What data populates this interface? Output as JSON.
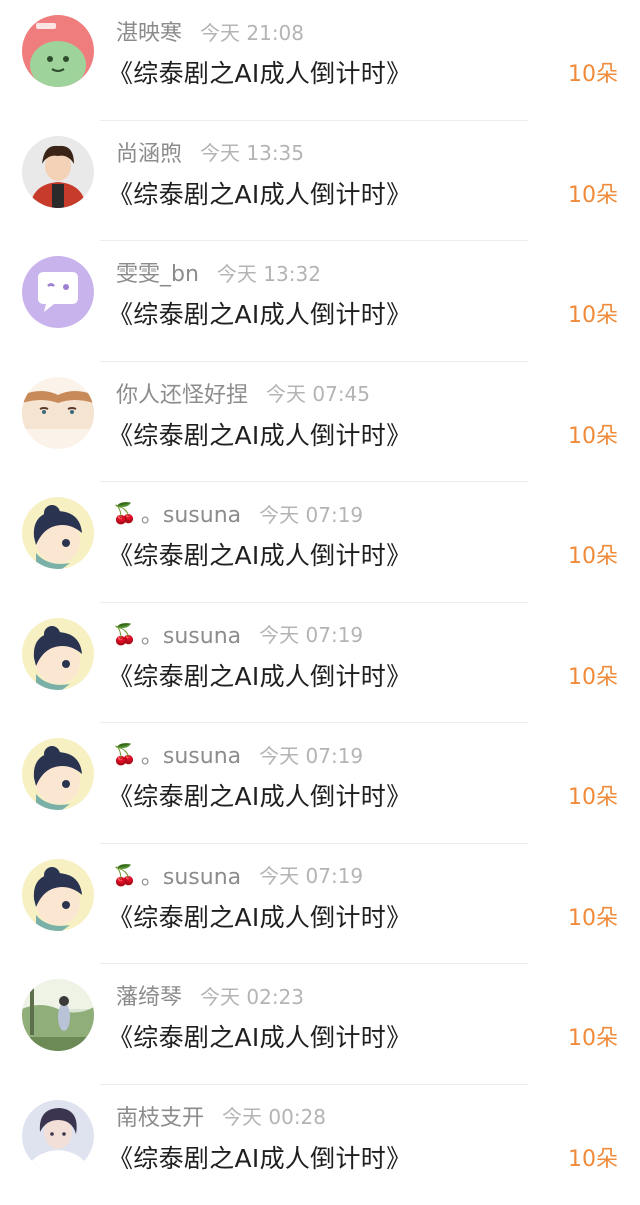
{
  "rows": [
    {
      "emoji": "",
      "username": "湛映寒",
      "time": "今天 21:08",
      "title": "《综泰剧之AI成人倒计时》",
      "gift": "10朵",
      "avatar_icon": "green-cartoon-avatar-icon"
    },
    {
      "emoji": "",
      "username": "尚涵煦",
      "time": "今天 13:35",
      "title": "《综泰剧之AI成人倒计时》",
      "gift": "10朵",
      "avatar_icon": "boy-photo-avatar-icon"
    },
    {
      "emoji": "",
      "username": "雯雯_bn",
      "time": "今天 13:32",
      "title": "《综泰剧之AI成人倒计时》",
      "gift": "10朵",
      "avatar_icon": "purple-chat-avatar-icon"
    },
    {
      "emoji": "",
      "username": "你人还怪好捏",
      "time": "今天 07:45",
      "title": "《综泰剧之AI成人倒计时》",
      "gift": "10朵",
      "avatar_icon": "anime-boy-avatar-icon"
    },
    {
      "emoji": "🍒",
      "username": "。susuna",
      "time": "今天 07:19",
      "title": "《综泰剧之AI成人倒计时》",
      "gift": "10朵",
      "avatar_icon": "cartoon-girl-avatar-icon"
    },
    {
      "emoji": "🍒",
      "username": "。susuna",
      "time": "今天 07:19",
      "title": "《综泰剧之AI成人倒计时》",
      "gift": "10朵",
      "avatar_icon": "cartoon-girl-avatar-icon"
    },
    {
      "emoji": "🍒",
      "username": "。susuna",
      "time": "今天 07:19",
      "title": "《综泰剧之AI成人倒计时》",
      "gift": "10朵",
      "avatar_icon": "cartoon-girl-avatar-icon"
    },
    {
      "emoji": "🍒",
      "username": "。susuna",
      "time": "今天 07:19",
      "title": "《综泰剧之AI成人倒计时》",
      "gift": "10朵",
      "avatar_icon": "cartoon-girl-avatar-icon"
    },
    {
      "emoji": "",
      "username": "藩绮琴",
      "time": "今天 02:23",
      "title": "《综泰剧之AI成人倒计时》",
      "gift": "10朵",
      "avatar_icon": "landscape-avatar-icon"
    },
    {
      "emoji": "",
      "username": "南枝支开",
      "time": "今天 00:28",
      "title": "《综泰剧之AI成人倒计时》",
      "gift": "10朵",
      "avatar_icon": "portrait-avatar-icon"
    }
  ],
  "colors": {
    "username": "#8c8c8c",
    "time": "#b4b4b4",
    "title": "#1f1f1f",
    "gift": "#f08b3b",
    "divider": "#ececec"
  }
}
